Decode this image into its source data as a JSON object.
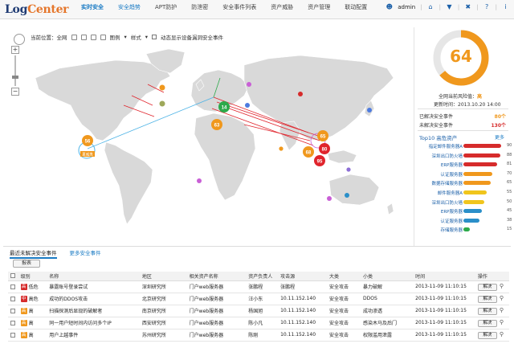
{
  "header": {
    "logo_log": "Log",
    "logo_center": "Center",
    "nav": [
      {
        "label": "实时安全"
      },
      {
        "label": "安全趋势"
      },
      {
        "label": "APT防护"
      },
      {
        "label": "防泄密"
      },
      {
        "label": "安全事件列表"
      },
      {
        "label": "资产威胁"
      },
      {
        "label": "资产管理"
      },
      {
        "label": "联动配置"
      }
    ],
    "user": "admin",
    "icons": [
      "user-icon",
      "home-icon",
      "filter-icon",
      "tools-icon",
      "help-icon",
      "info-icon"
    ]
  },
  "map": {
    "toolbar": {
      "location": "当前位置：全网",
      "layer_label": "图例",
      "style_label": "样式",
      "checkbox_label": "动态显示设备漏洞安全事件"
    },
    "zoom_plus": "+",
    "zoom_minus": "−",
    "markers": [
      {
        "label": "14",
        "color": "#2daa4b"
      },
      {
        "label": "63",
        "color": "#f0981d"
      },
      {
        "label": "56",
        "color": "#f0981d"
      },
      {
        "label": "65",
        "color": "#f0981d"
      },
      {
        "label": "68",
        "color": "#f0981d"
      },
      {
        "label": "80",
        "color": "#e0242c"
      },
      {
        "label": "95",
        "color": "#e0242c"
      }
    ],
    "city_tag": "夏威夷"
  },
  "risk": {
    "score": "64",
    "status_label": "全网当前风险值：",
    "status_level": "高",
    "updated": "更新时间：2013.10.20 14:00",
    "resolved_label": "已解决安全事件",
    "resolved_value": "80个",
    "unresolved_label": "未解决安全事件",
    "unresolved_value": "130个"
  },
  "top10": {
    "title": "Top10 高危资产",
    "more": "更多",
    "items": [
      {
        "name": "指定邮件服务器A",
        "value": 90,
        "color": "#d62b2b"
      },
      {
        "name": "深圳出口防火墙",
        "value": 88,
        "color": "#d62b2b"
      },
      {
        "name": "ERP服务器",
        "value": 81,
        "color": "#d62b2b"
      },
      {
        "name": "认证服务器",
        "value": 70,
        "color": "#f0981d"
      },
      {
        "name": "数据存储服务器",
        "value": 65,
        "color": "#f0981d"
      },
      {
        "name": "邮件服务器A",
        "value": 55,
        "color": "#f0c51d"
      },
      {
        "name": "深圳出口防火墙",
        "value": 50,
        "color": "#f0c51d"
      },
      {
        "name": "ERP服务器",
        "value": 45,
        "color": "#2a8fc9"
      },
      {
        "name": "认证服务器",
        "value": 38,
        "color": "#2a8fc9"
      },
      {
        "name": "存储服务器",
        "value": 15,
        "color": "#2daa4b"
      }
    ]
  },
  "events": {
    "tab_active": "最近未解决安全事件",
    "tab_more": "更多安全事件",
    "action_button": "报表",
    "columns": [
      "级别",
      "名称",
      "地区",
      "相关资产名称",
      "资产负责人",
      "攻击源",
      "大类",
      "小类",
      "时间",
      "操作"
    ],
    "rows": [
      {
        "level": "高",
        "level_color": "#d62b2b",
        "level_text": "低危",
        "name": "暴露账号登录尝试",
        "region": "深圳研究所",
        "asset": "门户web服务器",
        "owner": "张鹏程",
        "source": "张鹏程",
        "category": "安全攻击",
        "sub": "暴力破解",
        "time": "2013-11-09 11:10:15",
        "op": "解决"
      },
      {
        "level": "中",
        "level_color": "#d62b2b",
        "level_text": "高危",
        "name": "成功的DDOS攻击",
        "region": "北京研究所",
        "asset": "门户web服务器",
        "owner": "汪小东",
        "source": "10.11.152.140",
        "category": "安全攻击",
        "sub": "DDOS",
        "time": "2013-11-09 11:10:15",
        "op": "解决"
      },
      {
        "level": "高",
        "level_color": "#f0981d",
        "level_text": "高",
        "name": "扫描探测后显现的破解者",
        "region": "南京研究所",
        "asset": "门户web服务器",
        "owner": "杨国旭",
        "source": "10.11.152.140",
        "category": "安全攻击",
        "sub": "成功渗透",
        "time": "2013-11-09 11:10:15",
        "op": "解决"
      },
      {
        "level": "高",
        "level_color": "#f0981d",
        "level_text": "高",
        "name": "同一用户短时间内访问多个IP",
        "region": "西安研究所",
        "asset": "门户web服务器",
        "owner": "陈小凡",
        "source": "10.11.152.140",
        "category": "安全攻击",
        "sub": "感染木马及后门",
        "time": "2013-11-09 11:10:15",
        "op": "解决"
      },
      {
        "level": "高",
        "level_color": "#f0981d",
        "level_text": "高",
        "name": "用户上越事件",
        "region": "苏州研究所",
        "asset": "门户web服务器",
        "owner": "陈刚",
        "source": "10.11.152.140",
        "category": "安全攻击",
        "sub": "权限滥用泄露",
        "time": "2013-11-09 11:10:15",
        "op": "解决"
      }
    ]
  }
}
